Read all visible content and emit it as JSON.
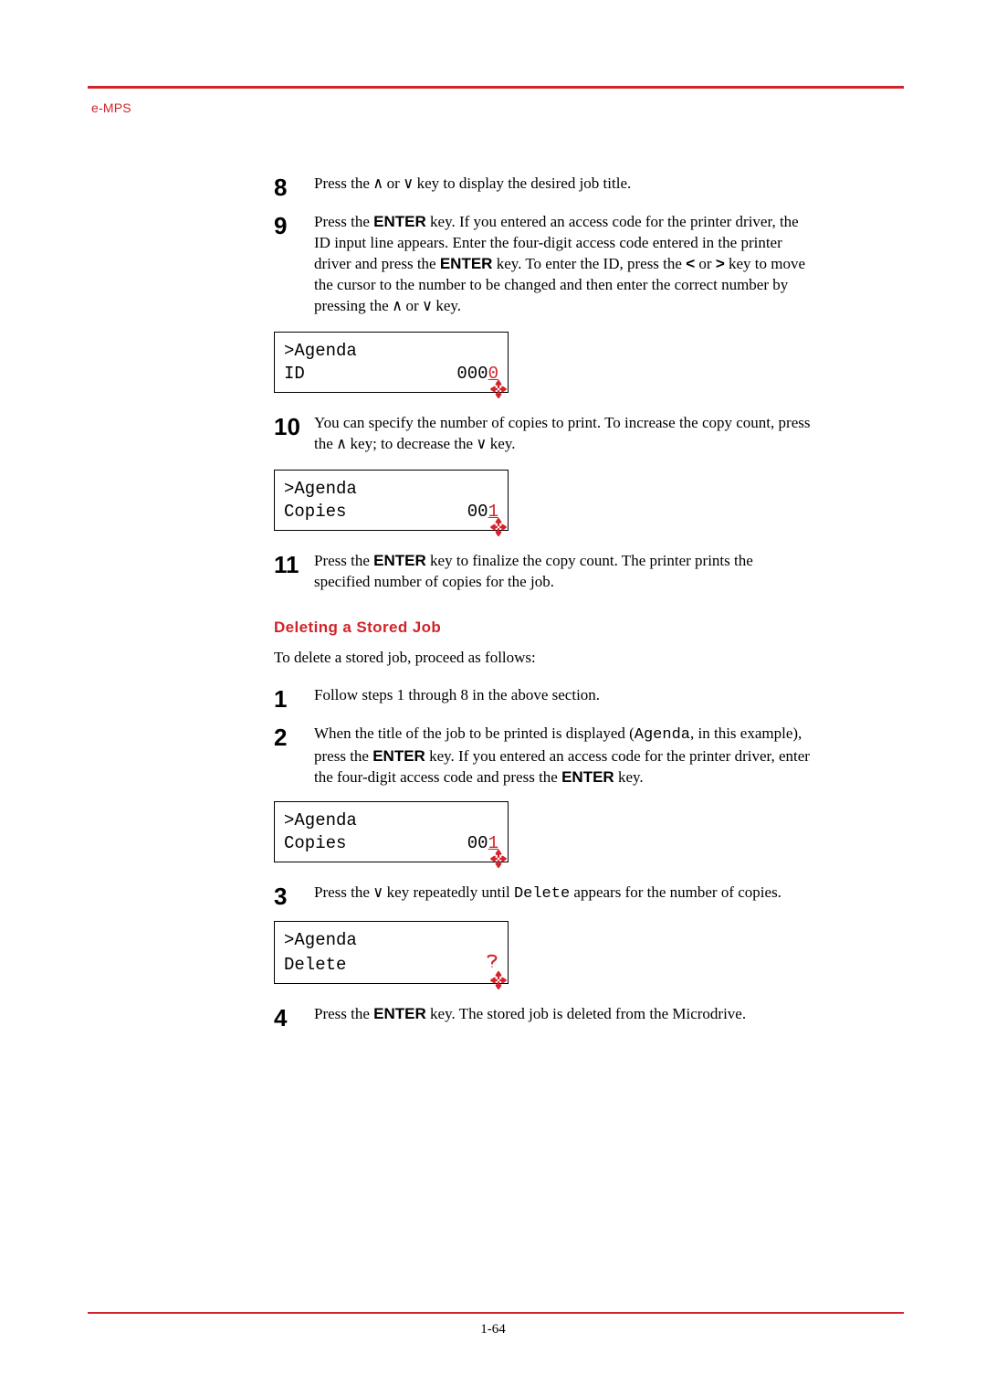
{
  "header": {
    "label": "e-MPS"
  },
  "glyphs": {
    "up": "∧",
    "down": "∨",
    "lt": "<",
    "gt": ">"
  },
  "steps_a": [
    {
      "num": "8",
      "html": "Press the {up} or {down} key to display the desired job title."
    },
    {
      "num": "9",
      "html": "Press the {ENTER} key. If you entered an access code for the printer driver, the ID input line appears. Enter the four-digit access code entered in the printer driver and press the {ENTER} key. To enter the ID, press the {lt} or {gt} key to move the cursor to the number to be changed and then enter the correct number by pressing the {up} or {down} key."
    }
  ],
  "lcd1": {
    "line1": ">Agenda",
    "line2_left": " ID",
    "line2_plain": "000",
    "line2_cursor": "0"
  },
  "steps_b": [
    {
      "num": "10",
      "html": "You can specify the number of copies to print. To increase the copy count, press the {up} key; to decrease the {down} key."
    }
  ],
  "lcd2": {
    "line1": ">Agenda",
    "line2_left": " Copies",
    "line2_plain": "00",
    "line2_cursor": "1"
  },
  "steps_c": [
    {
      "num": "11",
      "html": "Press the {ENTER} key to finalize the copy count. The printer prints the specified number of copies for the job."
    }
  ],
  "section": {
    "title": "Deleting a Stored Job",
    "intro": "To delete a stored job, proceed as follows:"
  },
  "steps_d": [
    {
      "num": "1",
      "html": "Follow steps 1 through 8 in the above section."
    },
    {
      "num": "2",
      "html": "When the title of the job to be printed is displayed ({mono:Agenda}, in this example), press the {ENTER} key. If you entered an access code for the printer driver, enter the four-digit access code and press the {ENTER} key."
    }
  ],
  "lcd3": {
    "line1": ">Agenda",
    "line2_left": " Copies",
    "line2_plain": "00",
    "line2_cursor": "1"
  },
  "steps_e": [
    {
      "num": "3",
      "html": "Press the {down} key repeatedly until {mono:Delete} appears for the number of copies."
    }
  ],
  "lcd4": {
    "line1": ">Agenda",
    "line2_left": " Delete",
    "line2_plain": "",
    "line2_cursor": "",
    "question": true
  },
  "steps_f": [
    {
      "num": "4",
      "html": "Press the {ENTER} key. The stored job is deleted from the Microdrive."
    }
  ],
  "page_number": "1-64"
}
